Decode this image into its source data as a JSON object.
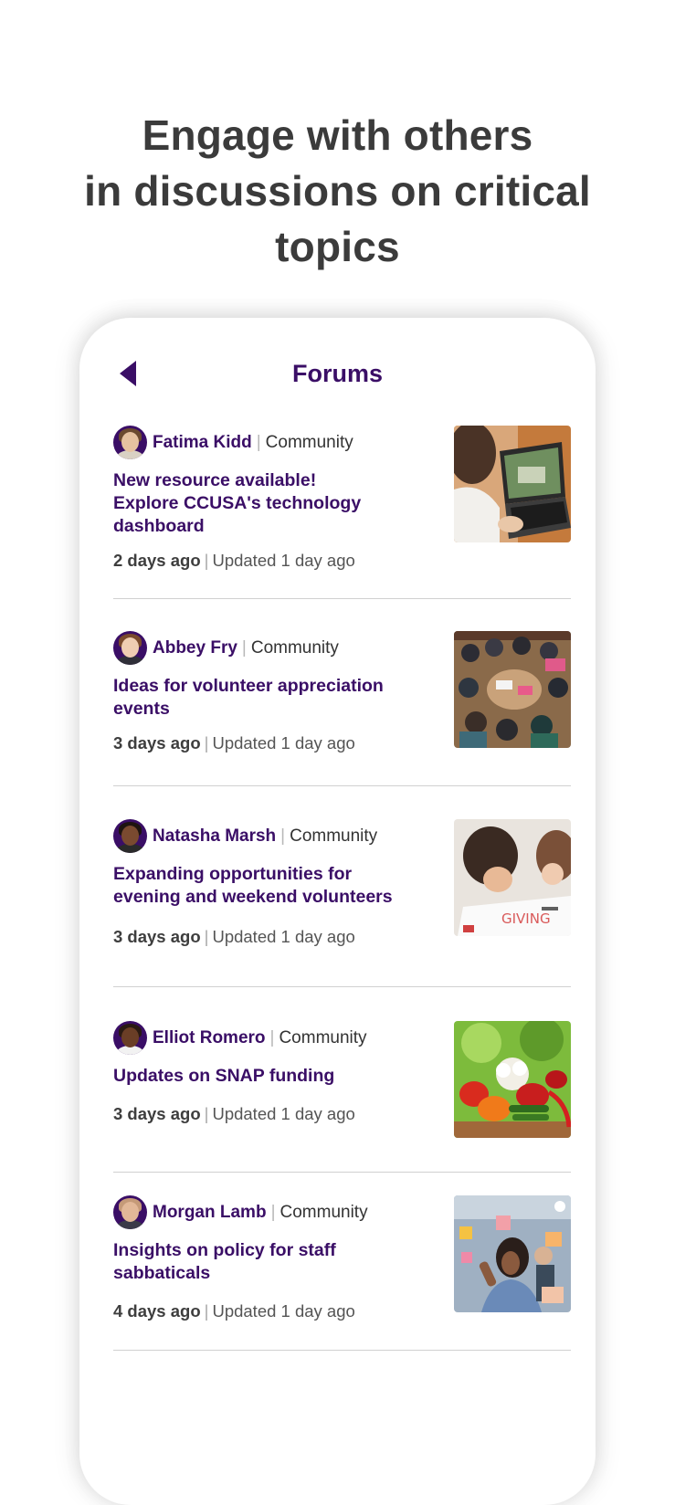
{
  "headline": {
    "lines": [
      "Engage with others",
      "in discussions on critical",
      "topics"
    ]
  },
  "screen": {
    "title": "Forums",
    "back_icon": "chevron-left-icon"
  },
  "posts": [
    {
      "author": "Fatima Kidd",
      "category": "Community",
      "title_lines": [
        "New resource available!",
        "Explore CCUSA's technology",
        "dashboard"
      ],
      "posted": "2 days ago",
      "updated": "Updated 1 day ago",
      "image": "laptop-photo"
    },
    {
      "author": "Abbey Fry",
      "category": "Community",
      "title_lines": [
        "Ideas for volunteer appreciation",
        "events"
      ],
      "posted": "3 days ago",
      "updated": "Updated 1 day ago",
      "image": "group-meeting-photo"
    },
    {
      "author": "Natasha Marsh",
      "category": "Community",
      "title_lines": [
        "Expanding opportunities for",
        "evening and weekend volunteers"
      ],
      "posted": "3 days ago",
      "updated": "Updated 1 day ago",
      "image": "children-drawing-photo",
      "image_text": "GIVING"
    },
    {
      "author": "Elliot Romero",
      "category": "Community",
      "title_lines": [
        "Updates on SNAP funding"
      ],
      "posted": "3 days ago",
      "updated": "Updated 1 day ago",
      "image": "vegetables-photo"
    },
    {
      "author": "Morgan Lamb",
      "category": "Community",
      "title_lines": [
        "Insights on policy for staff",
        "sabbaticals"
      ],
      "posted": "4 days ago",
      "updated": "Updated 1 day ago",
      "image": "sticky-notes-photo"
    }
  ],
  "colors": {
    "brand_purple": "#3a0e66",
    "headline_gray": "#3b3b3b",
    "divider": "#d0d0d0"
  }
}
